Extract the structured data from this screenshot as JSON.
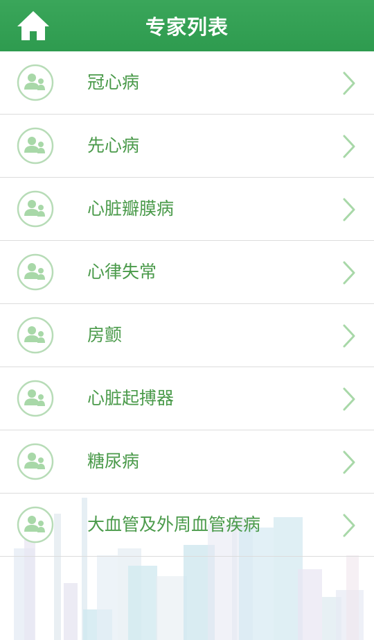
{
  "header": {
    "title": "专家列表",
    "home_icon": "home-icon"
  },
  "items": [
    {
      "label": "冠心病"
    },
    {
      "label": "先心病"
    },
    {
      "label": "心脏瓣膜病"
    },
    {
      "label": "心律失常"
    },
    {
      "label": "房颤"
    },
    {
      "label": "心脏起搏器"
    },
    {
      "label": "糖尿病"
    },
    {
      "label": "大血管及外周血管疾病"
    }
  ],
  "colors": {
    "header_bg": "#2e9b4f",
    "label_text": "#4a9a4a",
    "icon_green": "#a8d8a8"
  }
}
